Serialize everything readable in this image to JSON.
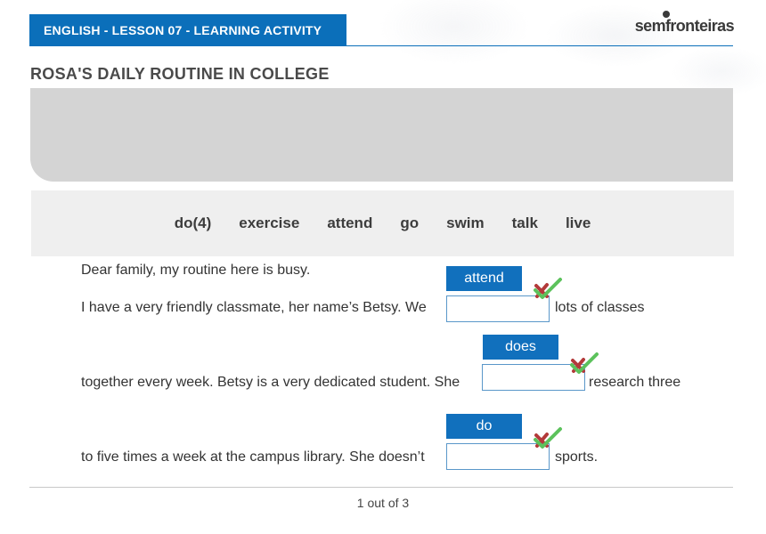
{
  "header": {
    "tab_title": "ENGLISH - LESSON 07 - LEARNING ACTIVITY",
    "logo_text": "semfronteiras",
    "accent_color": "#0b6fba"
  },
  "page_title": "ROSA'S DAILY ROUTINE IN COLLEGE",
  "word_bank": [
    "do(4)",
    "exercise",
    "attend",
    "go",
    "swim",
    "talk",
    "live"
  ],
  "text": {
    "line1": "Dear family, my routine here is busy.",
    "line2_before": "I have a very friendly classmate, her name’s Betsy. We",
    "line2_after": "lots of classes",
    "line3_before": "together every week. Betsy is a very dedicated student. She",
    "line3_after": "research three",
    "line4_before": "to five times a week at the campus library. She doesn’t",
    "line4_after": "sports."
  },
  "answers": {
    "blank1": "attend",
    "blank2": "does",
    "blank3": "do",
    "answer_color": "#1170bd"
  },
  "status_icons": [
    "check-mark-icon",
    "check-mark-icon",
    "check-mark-icon"
  ],
  "pagination": "1 out of 3"
}
